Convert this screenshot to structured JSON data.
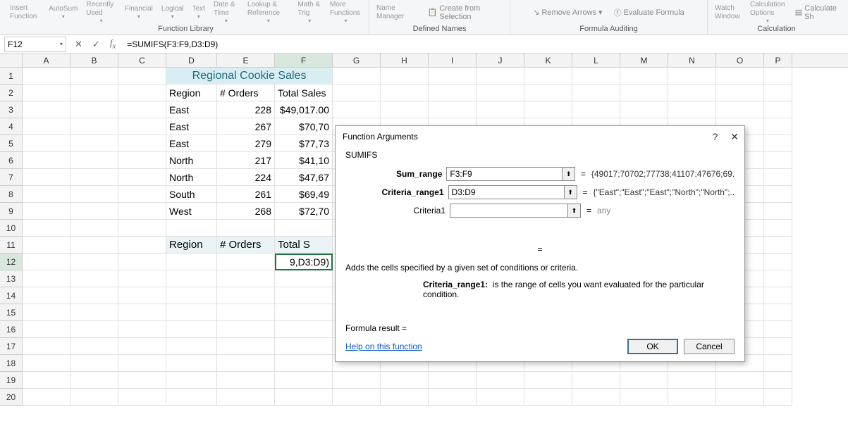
{
  "ribbon": {
    "group1": {
      "insert_fn": "Insert\nFunction",
      "autosum": "AutoSum",
      "recently": "Recently\nUsed",
      "financial": "Financial",
      "logical": "Logical",
      "text": "Text",
      "datetime": "Date &\nTime",
      "lookup": "Lookup &\nReference",
      "math": "Math &\nTrig",
      "more": "More\nFunctions",
      "label": "Function Library"
    },
    "group2": {
      "name_mgr": "Name\nManager",
      "create_sel": "Create from Selection",
      "label": "Defined Names"
    },
    "group3": {
      "remove_arrows": "Remove Arrows",
      "eval": "Evaluate Formula",
      "label": "Formula Auditing"
    },
    "group4": {
      "watch": "Watch\nWindow",
      "calc_opts": "Calculation\nOptions",
      "calc_sheet": "Calculate Sh",
      "label": "Calculation"
    }
  },
  "name_box": "F12",
  "formula": "=SUMIFS(F3:F9,D3:D9)",
  "columns": [
    "A",
    "B",
    "C",
    "D",
    "E",
    "F",
    "G",
    "H",
    "I",
    "J",
    "K",
    "L",
    "M",
    "N",
    "O",
    "P"
  ],
  "rows": [
    "1",
    "2",
    "3",
    "4",
    "5",
    "6",
    "7",
    "8",
    "9",
    "10",
    "11",
    "12",
    "13",
    "14",
    "15",
    "16",
    "17",
    "18",
    "19",
    "20"
  ],
  "sheet": {
    "title": "Regional Cookie Sales",
    "h_region": "Region",
    "h_orders": "# Orders",
    "h_total": "Total Sales",
    "r3": {
      "region": "East",
      "orders": "228",
      "total": "$49,017.00"
    },
    "r4": {
      "region": "East",
      "orders": "267",
      "total": "$70,70"
    },
    "r5": {
      "region": "East",
      "orders": "279",
      "total": "$77,73"
    },
    "r6": {
      "region": "North",
      "orders": "217",
      "total": "$41,10"
    },
    "r7": {
      "region": "North",
      "orders": "224",
      "total": "$47,67"
    },
    "r8": {
      "region": "South",
      "orders": "261",
      "total": "$69,49"
    },
    "r9": {
      "region": "West",
      "orders": "268",
      "total": "$72,70"
    },
    "h2_region": "Region",
    "h2_orders": "# Orders",
    "h2_total": "Total S",
    "f12_disp": "9,D3:D9)"
  },
  "dialog": {
    "title": "Function Arguments",
    "fn": "SUMIFS",
    "args": {
      "sum_range": {
        "label": "Sum_range",
        "value": "F3:F9",
        "result": "{49017;70702;77738;41107;47676;69..."
      },
      "crit_range1": {
        "label": "Criteria_range1",
        "value": "D3:D9",
        "result": "{\"East\";\"East\";\"East\";\"North\";\"North\";..."
      },
      "criteria1": {
        "label": "Criteria1",
        "value": "",
        "result": "any"
      }
    },
    "eq_alone": "=",
    "desc_main": "Adds the cells specified by a given set of conditions or criteria.",
    "desc_sub_label": "Criteria_range1:",
    "desc_sub_text": "is the range of cells you want evaluated for the particular condition.",
    "formula_result": "Formula result =",
    "help": "Help on this function",
    "ok": "OK",
    "cancel": "Cancel"
  }
}
